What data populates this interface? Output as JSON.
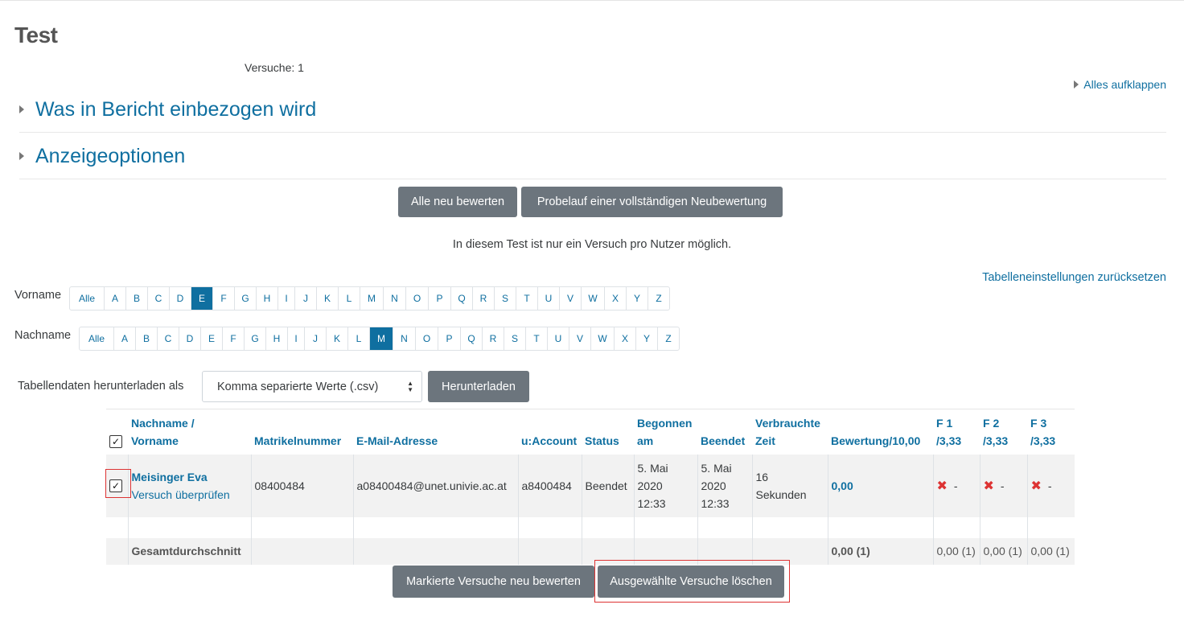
{
  "page": {
    "title": "Test",
    "attempts_summary": "Versuche: 1"
  },
  "expand_all": "Alles aufklappen",
  "sections": [
    {
      "label": "Was in Bericht einbezogen wird"
    },
    {
      "label": "Anzeigeoptionen"
    }
  ],
  "buttons": {
    "regrade_all": "Alle neu bewerten",
    "dry_run": "Probelauf einer vollständigen Neubewertung",
    "download": "Herunterladen",
    "regrade_selected": "Markierte Versuche neu bewerten",
    "delete_selected": "Ausgewählte Versuche löschen"
  },
  "notice": "In diesem Test ist nur ein Versuch pro Nutzer möglich.",
  "reset_table": "Tabelleneinstellungen zurücksetzen",
  "initials": {
    "firstname_label": "Vorname",
    "lastname_label": "Nachname",
    "all": "Alle",
    "letters": [
      "A",
      "B",
      "C",
      "D",
      "E",
      "F",
      "G",
      "H",
      "I",
      "J",
      "K",
      "L",
      "M",
      "N",
      "O",
      "P",
      "Q",
      "R",
      "S",
      "T",
      "U",
      "V",
      "W",
      "X",
      "Y",
      "Z"
    ],
    "firstname_selected": "E",
    "lastname_selected": "M"
  },
  "download": {
    "label": "Tabellendaten herunterladen als",
    "format": "Komma separierte Werte (.csv)"
  },
  "table": {
    "headers": {
      "name_line1": "Nachname /",
      "name_line2": "Vorname",
      "matrikel": "Matrikelnummer",
      "email": "E-Mail-Adresse",
      "account": "u:Account",
      "status": "Status",
      "started_line1": "Begonnen",
      "started_line2": "am",
      "finished": "Beendet",
      "time_line1": "Verbrauchte",
      "time_line2": "Zeit",
      "grade": "Bewertung/10,00",
      "q1_line1": "F 1",
      "q1_line2": "/3,33",
      "q2_line1": "F 2",
      "q2_line2": "/3,33",
      "q3_line1": "F 3",
      "q3_line2": "/3,33"
    },
    "row": {
      "name": "Meisinger Eva",
      "review": "Versuch überprüfen",
      "matrikel": "08400484",
      "email": "a08400484@unet.univie.ac.at",
      "account": "a8400484",
      "status": "Beendet",
      "started_date": "5. Mai",
      "started_year": "2020",
      "started_time": "12:33",
      "finished_date": "5. Mai",
      "finished_year": "2020",
      "finished_time": "12:33",
      "time_line1": "16",
      "time_line2": "Sekunden",
      "grade": "0,00",
      "q1": "-",
      "q2": "-",
      "q3": "-"
    },
    "average": {
      "label": "Gesamtdurchschnitt",
      "grade": "0,00 (1)",
      "q1": "0,00 (1)",
      "q2": "0,00 (1)",
      "q3": "0,00 (1)"
    }
  }
}
